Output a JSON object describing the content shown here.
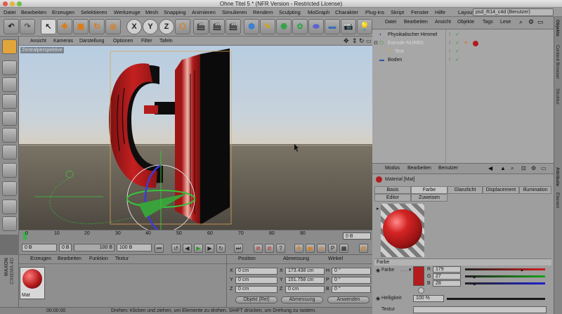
{
  "window": {
    "title": "Ohne Titel 5 * (NFR Version - Restricted License)"
  },
  "menubar": {
    "items": [
      "Datei",
      "Bearbeiten",
      "Erzeugen",
      "Selektieren",
      "Werkzeuge",
      "Mesh",
      "Snapping",
      "Animieren",
      "Simulieren",
      "Rendern",
      "Sculpting",
      "MoGraph",
      "Charakter",
      "Plug-ins",
      "Skript",
      "Fenster",
      "Hilfe"
    ],
    "layout_label": "Layout:",
    "layout_value": "psd_R14_c4d (Benutzer)"
  },
  "toolbar": {
    "axis_x": "X",
    "axis_y": "Y",
    "axis_z": "Z"
  },
  "viewport": {
    "menu": [
      "Ansicht",
      "Kameras",
      "Darstellung",
      "Optionen",
      "Filter",
      "Tafeln"
    ],
    "camera_label": "Zentralperspektive"
  },
  "timeline": {
    "ticks": [
      "0",
      "10",
      "20",
      "30",
      "40",
      "50",
      "60",
      "70",
      "80",
      "90"
    ],
    "end_frame": "0 B"
  },
  "transport": {
    "current_frame": "0 B",
    "min_frame": "0 B",
    "max_frame": "100 B",
    "end_frame": "100 B"
  },
  "material_manager": {
    "menu": [
      "Erzeugen",
      "Bearbeiten",
      "Funktion",
      "Textur"
    ],
    "materials": [
      {
        "name": "Mat"
      }
    ]
  },
  "coordinates": {
    "headers": {
      "position": "Position",
      "size": "Abmessung",
      "rotation": "Winkel"
    },
    "rows": [
      {
        "axis": "X",
        "position": "0 cm",
        "size": "173.438 cm",
        "rot_label": "H",
        "rotation": "0 °"
      },
      {
        "axis": "Y",
        "position": "0 cm",
        "size": "151.758 cm",
        "rot_label": "P",
        "rotation": "0 °"
      },
      {
        "axis": "Z",
        "position": "0 cm",
        "size": "0 cm",
        "rot_label": "B",
        "rotation": "0 °"
      }
    ],
    "mode_select": "Objekt (Rel)",
    "size_select": "Abmessung",
    "apply_label": "Anwenden"
  },
  "statusbar": {
    "time": "00:00:00",
    "message": "Drehen: Klicken und ziehen, um Elemente zu drehen. SHIFT drücken, um Drehung zu rastern."
  },
  "object_manager": {
    "menu": [
      "Datei",
      "Bearbeiten",
      "Ansicht",
      "Objekte",
      "Tags",
      "Lese"
    ],
    "objects": [
      {
        "name": "Physikalischer Himmel",
        "indent": 0
      },
      {
        "name": "Extrude-NURBS",
        "indent": 0
      },
      {
        "name": "Text",
        "indent": 1
      },
      {
        "name": "Boden",
        "indent": 0
      }
    ]
  },
  "attributes": {
    "menu": [
      "Modus",
      "Bearbeiten",
      "Benutzer"
    ],
    "title": "Material [Mat]",
    "tabs_row1": [
      "Basis",
      "Farbe",
      "Glanzlicht",
      "Displacement",
      "Illumination"
    ],
    "tabs_row2": [
      "Editor",
      "Zuweisen"
    ],
    "active_tab": "Farbe",
    "section": "Farbe",
    "color_label": "Farbe",
    "color_hex": "#b31b1c",
    "channels": [
      {
        "label": "R",
        "value": "179",
        "max": 255,
        "color": "#d21c1c"
      },
      {
        "label": "G",
        "value": "27",
        "max": 255,
        "color": "#1aa11a"
      },
      {
        "label": "B",
        "value": "28",
        "max": 255,
        "color": "#2020d0"
      }
    ],
    "brightness_label": "Helligkeit",
    "brightness_value": "100 %",
    "texture_label": "Textur"
  },
  "side_tabs": {
    "right_top": [
      "Objekte",
      "Content Browser",
      "Struktur"
    ],
    "right_bottom": [
      "Attribute",
      "Ebenen"
    ]
  },
  "branding": {
    "line1": "MAXON",
    "line2": "CINEMA 4D"
  },
  "colors": {
    "text_red": "#b31b1c",
    "sky_top": "#a9c4dc",
    "ground": "#5a544a"
  }
}
